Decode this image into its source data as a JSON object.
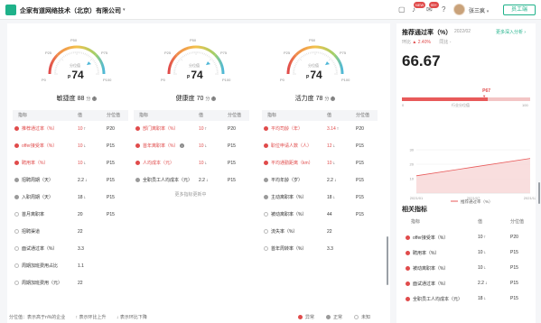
{
  "header": {
    "company": "企家有道网络技术（北京）有限公司",
    "caret": "▾",
    "badge_new": "NEW",
    "badge_count": "99+",
    "user_name": "张三疯",
    "user_caret": "▾",
    "staff_button": "员工端"
  },
  "gauges": [
    {
      "label_p25": "P25",
      "label_p50": "P50",
      "label_p75": "P75",
      "label_p0": "P0",
      "label_p100": "P100",
      "caption": "分位值",
      "p_prefix": "P",
      "p_value": "74",
      "p_fraction": 0.74,
      "score_name": "敏捷度",
      "score_value": "88",
      "score_unit": "分"
    },
    {
      "label_p25": "P25",
      "label_p50": "P50",
      "label_p75": "P75",
      "label_p0": "P0",
      "label_p100": "P100",
      "caption": "分位值",
      "p_prefix": "P",
      "p_value": "74",
      "p_fraction": 0.74,
      "score_name": "健康度",
      "score_value": "70",
      "score_unit": "分"
    },
    {
      "label_p25": "P25",
      "label_p50": "P50",
      "label_p75": "P75",
      "label_p0": "P0",
      "label_p100": "P100",
      "caption": "分位值",
      "p_prefix": "P",
      "p_value": "74",
      "p_fraction": 0.74,
      "score_name": "活力度",
      "score_value": "78",
      "score_unit": "分"
    }
  ],
  "tables": [
    {
      "headers": [
        "指标",
        "值",
        "分位值"
      ],
      "rows": [
        {
          "status": "red",
          "name": "推荐通过率（%）",
          "value": "10",
          "arrow": "↑",
          "pct": "P20",
          "hl": true
        },
        {
          "status": "red",
          "name": "offer接受率（%）",
          "value": "10",
          "arrow": "↓",
          "pct": "P15",
          "hl": true
        },
        {
          "status": "red",
          "name": "聘用率（%）",
          "value": "10",
          "arrow": "↓",
          "pct": "P15",
          "hl": true
        },
        {
          "status": "grey",
          "name": "招聘周期（天）",
          "value": "2.2",
          "arrow": "↓",
          "pct": "P15",
          "hl": false
        },
        {
          "status": "grey",
          "name": "入职周期（天）",
          "value": "18",
          "arrow": "↓",
          "pct": "P15",
          "hl": false
        },
        {
          "status": "none",
          "name": "首月离职率",
          "value": "20",
          "arrow": "",
          "pct": "P15",
          "hl": false
        },
        {
          "status": "none",
          "name": "招聘渠道",
          "value": "22",
          "arrow": "",
          "pct": "",
          "hl": false
        },
        {
          "status": "none",
          "name": "面试通过率（%）",
          "value": "3.3",
          "arrow": "",
          "pct": "",
          "hl": false
        },
        {
          "status": "none",
          "name": "周期加班费用占比",
          "value": "1.1",
          "arrow": "",
          "pct": "",
          "hl": false
        },
        {
          "status": "none",
          "name": "周期加班费用（元）",
          "value": "22",
          "arrow": "",
          "pct": "",
          "hl": false
        }
      ]
    },
    {
      "headers": [
        "指标",
        "值",
        "分位值"
      ],
      "rows": [
        {
          "status": "red",
          "name": "部门离职率（%）",
          "value": "10",
          "arrow": "↑",
          "pct": "P20",
          "hl": true
        },
        {
          "status": "red",
          "name": "首年离职率（%）",
          "value": "10",
          "arrow": "↓",
          "pct": "P15",
          "hl": true,
          "info": true
        },
        {
          "status": "red",
          "name": "人均成本（元）",
          "value": "10",
          "arrow": "↓",
          "pct": "P15",
          "hl": true
        },
        {
          "status": "grey",
          "name": "全职员工人均成本（元）",
          "value": "2.2",
          "arrow": "↓",
          "pct": "P15",
          "hl": false
        }
      ],
      "more": "更多指标更新中"
    },
    {
      "headers": [
        "指标",
        "值",
        "分位值"
      ],
      "rows": [
        {
          "status": "red",
          "name": "平均司龄（年）",
          "value": "3.14",
          "arrow": "↑",
          "pct": "P20",
          "hl": true
        },
        {
          "status": "red",
          "name": "职位申请人数（人）",
          "value": "12",
          "arrow": "↓",
          "pct": "P15",
          "hl": true
        },
        {
          "status": "red",
          "name": "平均通勤距离（km）",
          "value": "10",
          "arrow": "↓",
          "pct": "P15",
          "hl": true
        },
        {
          "status": "grey",
          "name": "平均年龄（岁）",
          "value": "2.2",
          "arrow": "↓",
          "pct": "P15",
          "hl": false
        },
        {
          "status": "grey",
          "name": "主动离职率（%）",
          "value": "18",
          "arrow": "↓",
          "pct": "P15",
          "hl": false
        },
        {
          "status": "none",
          "name": "被动离职率（%）",
          "value": "44",
          "arrow": "",
          "pct": "P15",
          "hl": false
        },
        {
          "status": "none",
          "name": "流失率（%）",
          "value": "22",
          "arrow": "",
          "pct": "",
          "hl": false
        },
        {
          "status": "none",
          "name": "首年周转率（%）",
          "value": "3.3",
          "arrow": "",
          "pct": "",
          "hl": false
        }
      ]
    }
  ],
  "legend": {
    "pct_desc": "分位值：表示高于n%的企业",
    "up_desc": "表示环比上升",
    "down_desc": "表示环比下降",
    "abnormal": "异常",
    "normal": "正常",
    "unknown": "未知"
  },
  "side": {
    "title": "推荐通过率（%）",
    "date": "2022/02",
    "link": "更多深入分析 ›",
    "mom_label": "环比",
    "mom_value": "▲ 2.40%",
    "yoy_label": "同比",
    "yoy_value": "-",
    "big_value": "66.67",
    "marker": "P67",
    "marker_fraction": 0.67,
    "scale_min": "0",
    "scale_label": "行业分位值",
    "scale_max": "100",
    "chart_ticks_y": [
      "30",
      "20",
      "10"
    ],
    "chart_ticks_x": [
      "2021/01",
      "2021/07",
      "2021/12"
    ],
    "chart_legend": "推荐通过率（%）",
    "related_title": "相关指标",
    "related_headers": [
      "指标",
      "值",
      "分位值"
    ],
    "related_rows": [
      {
        "name": "offer接受率（%）",
        "value": "10",
        "arrow": "↑",
        "pct": "P20"
      },
      {
        "name": "聘用率（%）",
        "value": "10",
        "arrow": "↓",
        "pct": "P15"
      },
      {
        "name": "被动离职率（%）",
        "value": "10",
        "arrow": "↓",
        "pct": "P15"
      },
      {
        "name": "面试通过率（%）",
        "value": "2.2",
        "arrow": "↓",
        "pct": "P15"
      },
      {
        "name": "全职员工人均成本（元）",
        "value": "18",
        "arrow": "↓",
        "pct": "P15"
      }
    ]
  },
  "colors": {
    "brand": "#1fb28a",
    "danger": "#e04b4b",
    "grey": "#9a9a9a"
  },
  "chart_data": {
    "type": "area",
    "x": [
      "2021/01",
      "2021/07",
      "2021/12"
    ],
    "series": [
      {
        "name": "推荐通过率（%）",
        "values": [
          12,
          18,
          24
        ]
      }
    ],
    "ylim": [
      0,
      30
    ],
    "title": "",
    "xlabel": "",
    "ylabel": ""
  }
}
